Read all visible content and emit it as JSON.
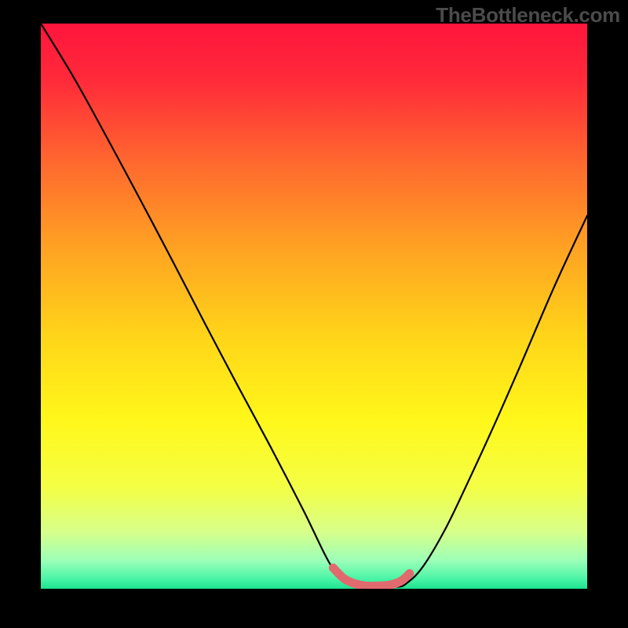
{
  "watermark": "TheBottleneck.com",
  "chart_data": {
    "type": "line",
    "title": "",
    "xlabel": "",
    "ylabel": "",
    "xlim": [
      0,
      1
    ],
    "ylim": [
      0,
      1
    ],
    "gradient_stops": [
      {
        "offset": 0.0,
        "color": "#ff153c"
      },
      {
        "offset": 0.1,
        "color": "#ff2a3a"
      },
      {
        "offset": 0.25,
        "color": "#ff6a2e"
      },
      {
        "offset": 0.4,
        "color": "#ffa322"
      },
      {
        "offset": 0.55,
        "color": "#ffd419"
      },
      {
        "offset": 0.7,
        "color": "#fff71a"
      },
      {
        "offset": 0.82,
        "color": "#f4ff45"
      },
      {
        "offset": 0.9,
        "color": "#d7ff8a"
      },
      {
        "offset": 0.95,
        "color": "#9cffb8"
      },
      {
        "offset": 0.985,
        "color": "#43f3a4"
      },
      {
        "offset": 1.0,
        "color": "#1de28e"
      }
    ],
    "series": [
      {
        "name": "bottleneck-curve",
        "x": [
          0.0,
          0.06,
          0.12,
          0.18,
          0.24,
          0.3,
          0.36,
          0.42,
          0.48,
          0.535,
          0.57,
          0.6,
          0.65,
          0.67,
          0.7,
          0.74,
          0.78,
          0.83,
          0.88,
          0.94,
          1.0
        ],
        "values": [
          1.0,
          0.905,
          0.8,
          0.692,
          0.582,
          0.47,
          0.36,
          0.252,
          0.14,
          0.035,
          0.01,
          0.003,
          0.003,
          0.01,
          0.04,
          0.105,
          0.185,
          0.29,
          0.4,
          0.535,
          0.66
        ],
        "color": "#000000"
      },
      {
        "name": "highlight-segment",
        "x": [
          0.535,
          0.555,
          0.575,
          0.595,
          0.615,
          0.64,
          0.66,
          0.675
        ],
        "values": [
          0.037,
          0.018,
          0.009,
          0.005,
          0.005,
          0.007,
          0.014,
          0.027
        ],
        "color": "#e16a6e",
        "stroke_width": 11
      }
    ]
  }
}
